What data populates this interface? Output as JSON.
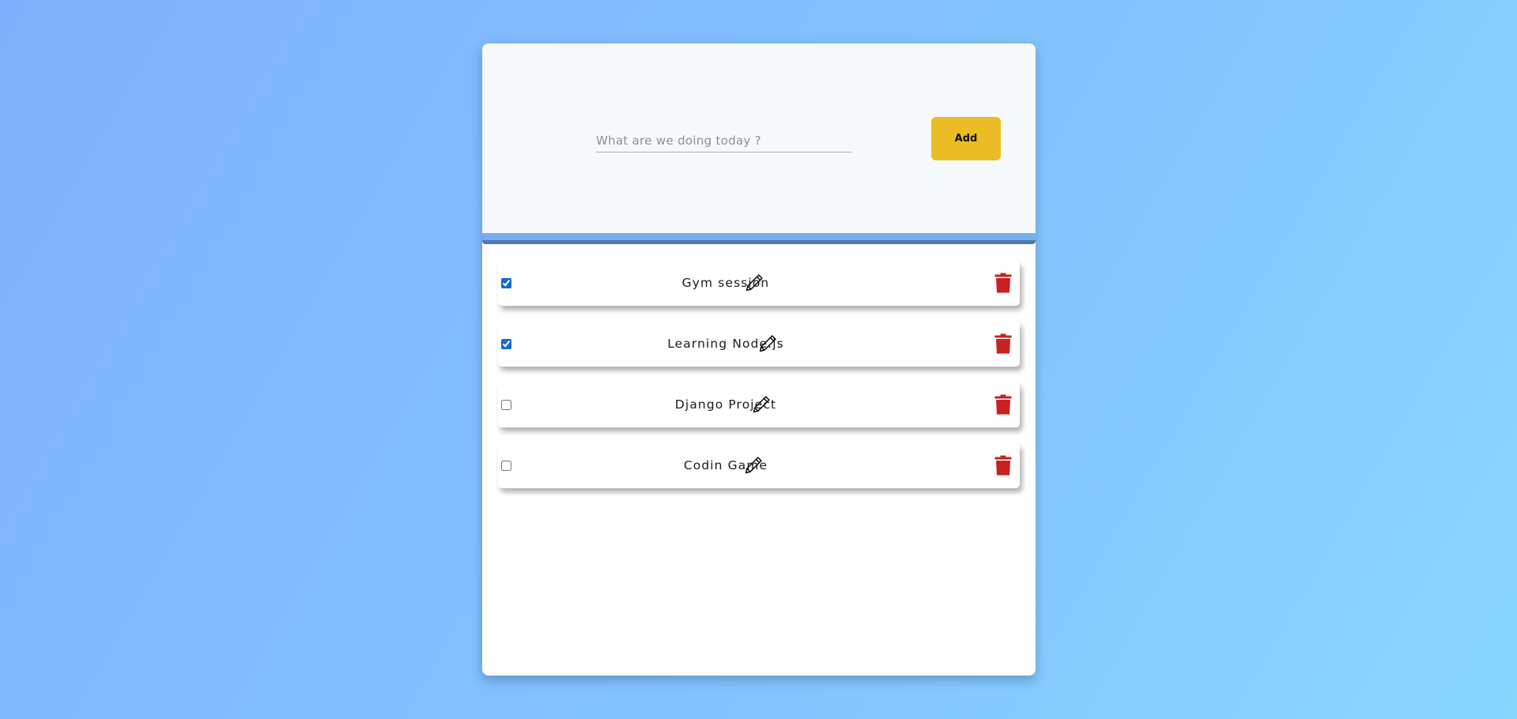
{
  "form": {
    "input_value": "",
    "input_placeholder": "What are we doing today ?",
    "add_label": "Add"
  },
  "tasks": [
    {
      "label": "Gym session",
      "done": true
    },
    {
      "label": "Learning Node.js",
      "done": true
    },
    {
      "label": "Django Project",
      "done": false
    },
    {
      "label": "Codin Game",
      "done": false
    }
  ],
  "icons": {
    "edit": "pencil-icon",
    "delete": "trash-icon"
  },
  "colors": {
    "accent": "#ebbd25",
    "delete": "#c92020",
    "checkbox": "#1769d6",
    "header_bar": "#75aef2"
  }
}
